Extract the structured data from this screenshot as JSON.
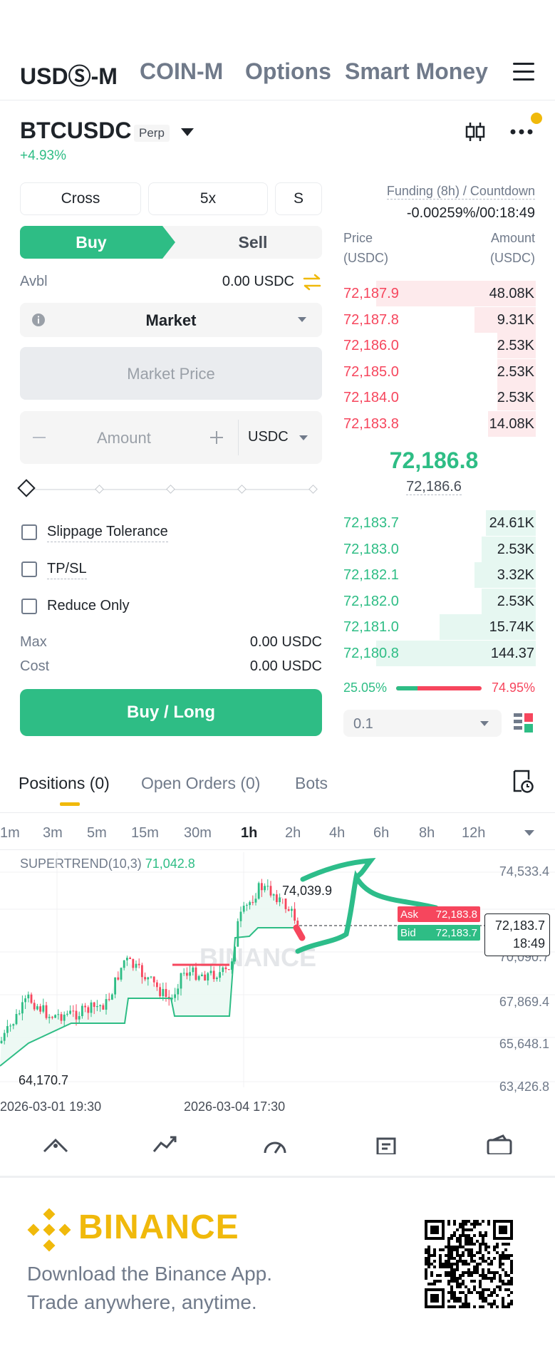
{
  "nav": {
    "tabs": [
      "USDⓈ-M",
      "COIN-M",
      "Options",
      "Smart Money"
    ]
  },
  "symbol": {
    "name": "BTCUSDC",
    "badge": "Perp",
    "change": "+4.93%"
  },
  "order_form": {
    "margin_mode": "Cross",
    "leverage": "5x",
    "asset_mode": "S",
    "buy_label": "Buy",
    "sell_label": "Sell",
    "avbl_label": "Avbl",
    "avbl_value": "0.00 USDC",
    "order_type": "Market",
    "price_placeholder": "Market Price",
    "amount_placeholder": "Amount",
    "amount_unit": "USDC",
    "slider_percent": 0,
    "options": [
      "Slippage Tolerance",
      "TP/SL",
      "Reduce Only"
    ],
    "max_label": "Max",
    "max_value": "0.00 USDC",
    "cost_label": "Cost",
    "cost_value": "0.00 USDC",
    "submit_label": "Buy / Long"
  },
  "orderbook": {
    "funding_label": "Funding (8h) / Countdown",
    "funding_value": "-0.00259%/00:18:49",
    "price_header": "Price",
    "price_unit": "(USDC)",
    "amount_header": "Amount",
    "amount_unit": "(USDC)",
    "asks": [
      {
        "price": "72,187.9",
        "amount": "48.08K",
        "depth": 0.83
      },
      {
        "price": "72,187.8",
        "amount": "9.31K",
        "depth": 0.32
      },
      {
        "price": "72,186.0",
        "amount": "2.53K",
        "depth": 0.2
      },
      {
        "price": "72,185.0",
        "amount": "2.53K",
        "depth": 0.2
      },
      {
        "price": "72,184.0",
        "amount": "2.53K",
        "depth": 0.2
      },
      {
        "price": "72,183.8",
        "amount": "14.08K",
        "depth": 0.25
      }
    ],
    "last_price": "72,186.8",
    "mark_price": "72,186.6",
    "bids": [
      {
        "price": "72,183.7",
        "amount": "24.61K",
        "depth": 0.26
      },
      {
        "price": "72,183.0",
        "amount": "2.53K",
        "depth": 0.28
      },
      {
        "price": "72,182.1",
        "amount": "3.32K",
        "depth": 0.32
      },
      {
        "price": "72,182.0",
        "amount": "2.53K",
        "depth": 0.28
      },
      {
        "price": "72,181.0",
        "amount": "15.74K",
        "depth": 0.5
      },
      {
        "price": "72,180.8",
        "amount": "144.37",
        "depth": 0.83
      }
    ],
    "bid_ratio": "25.05%",
    "ask_ratio": "74.95%",
    "bid_ratio_value": 25.05,
    "precision": "0.1"
  },
  "lower_tabs": [
    "Positions (0)",
    "Open Orders (0)",
    "Bots"
  ],
  "chart": {
    "timeframes": [
      "1m",
      "3m",
      "5m",
      "15m",
      "30m",
      "1h",
      "2h",
      "4h",
      "6h",
      "8h",
      "12h"
    ],
    "active_timeframe": "1h",
    "indicator_label": "SUPERTREND(10,3)",
    "indicator_value": "71,042.8",
    "y_ticks": [
      "74,533.4",
      "70,090.7",
      "67,869.4",
      "65,648.1",
      "63,426.8"
    ],
    "high_label": "74,039.9",
    "low_label": "64,170.7",
    "x_ticks": [
      "2026-03-01 19:30",
      "2026-03-04 17:30"
    ],
    "ask_label": "Ask",
    "ask_value": "72,183.8",
    "bid_label": "Bid",
    "bid_value": "72,183.7",
    "current_price": "72,183.7",
    "countdown": "18:49",
    "watermark": "BINANCE",
    "colors": {
      "up": "#2ebd85",
      "down": "#f6465d",
      "annotation": "#2dbd8a"
    }
  },
  "footer": {
    "logo": "BINANCE",
    "line1": "Download the Binance App.",
    "line2": "Trade anywhere, anytime."
  }
}
